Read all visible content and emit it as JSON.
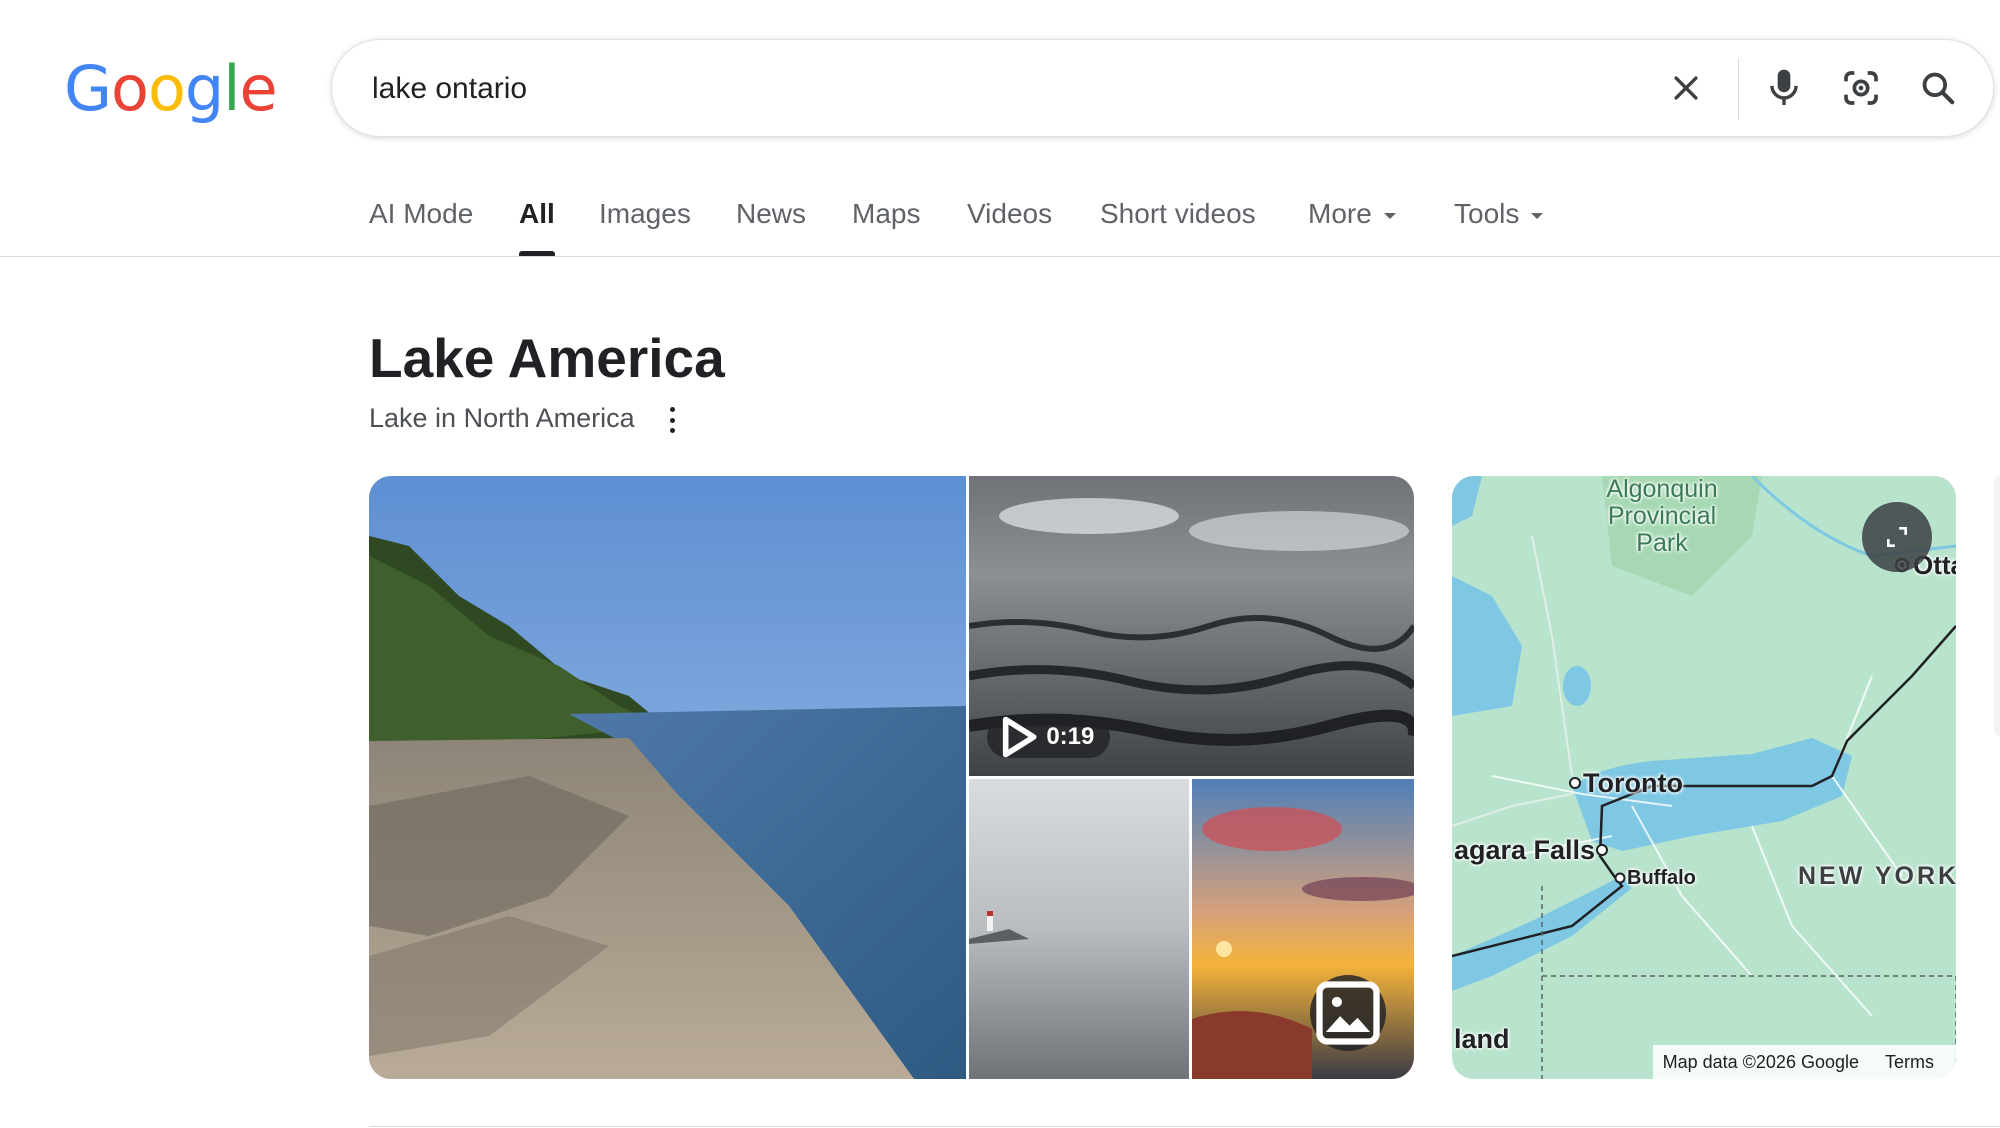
{
  "logo": {
    "text": "Google",
    "letters": [
      {
        "ch": "G",
        "color": "#4285F4"
      },
      {
        "ch": "o",
        "color": "#EA4335"
      },
      {
        "ch": "o",
        "color": "#FBBC05"
      },
      {
        "ch": "g",
        "color": "#4285F4"
      },
      {
        "ch": "l",
        "color": "#34A853"
      },
      {
        "ch": "e",
        "color": "#EA4335"
      }
    ]
  },
  "search": {
    "query": "lake ontario",
    "icons": [
      "close-icon",
      "microphone-icon",
      "google-lens-icon",
      "search-icon"
    ]
  },
  "tabs": [
    {
      "label": "AI Mode"
    },
    {
      "label": "All",
      "active": true
    },
    {
      "label": "Images"
    },
    {
      "label": "News"
    },
    {
      "label": "Maps"
    },
    {
      "label": "Videos"
    },
    {
      "label": "Short videos"
    },
    {
      "label": "More",
      "dropdown": true
    },
    {
      "label": "Tools",
      "dropdown": true
    }
  ],
  "knowledge_panel": {
    "title": "Lake America",
    "subtitle": "Lake in North America"
  },
  "gallery": {
    "video_duration": "0:19",
    "photos": [
      "beach-photo",
      "waves-video",
      "lighthouse-photo",
      "sunset-photo"
    ]
  },
  "map": {
    "labels": {
      "park_line1": "Algonquin",
      "park_line2": "Provincial",
      "park_line3": "Park",
      "ottawa": "Otta",
      "toronto": "Toronto",
      "niagara": "agara Falls",
      "buffalo": "Buffalo",
      "new_york": "NEW YORK",
      "island": "land"
    },
    "footer": {
      "attribution": "Map data ©2026 Google",
      "terms": "Terms"
    },
    "colors": {
      "land": "#b8e3cc",
      "water": "#7ec8e3",
      "park": "#9ed4a8"
    }
  }
}
